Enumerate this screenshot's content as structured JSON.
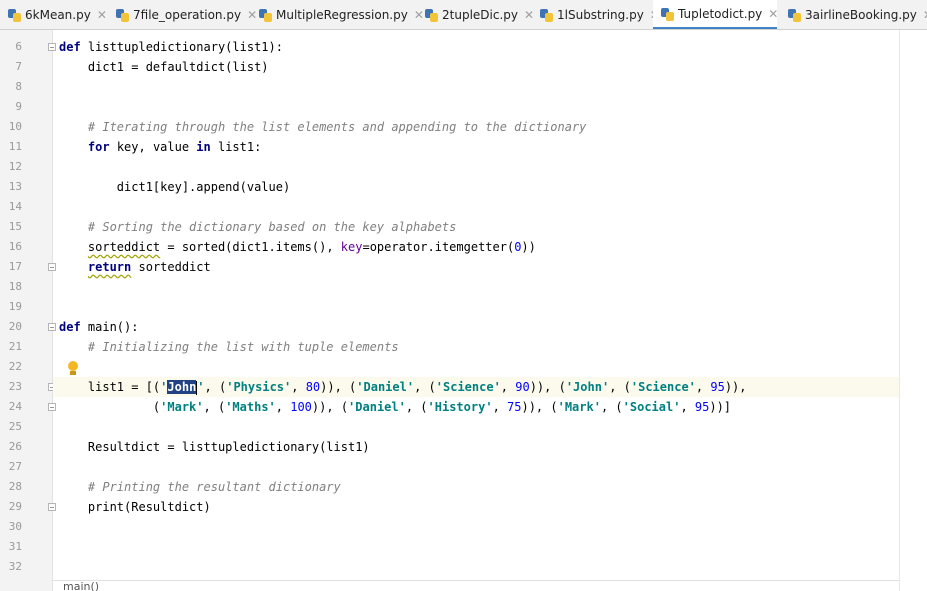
{
  "tabs": [
    {
      "label": "6kMean.py",
      "active": false
    },
    {
      "label": "7file_operation.py",
      "active": false
    },
    {
      "label": "MultipleRegression.py",
      "active": false
    },
    {
      "label": "2tupleDic.py",
      "active": false
    },
    {
      "label": "1lSubstring.py",
      "active": false
    },
    {
      "label": "Tupletodict.py",
      "active": true
    },
    {
      "label": "3airlineBooking.py",
      "active": false
    }
  ],
  "line_numbers": [
    "6",
    "7",
    "8",
    "9",
    "10",
    "11",
    "12",
    "13",
    "14",
    "15",
    "16",
    "17",
    "18",
    "19",
    "20",
    "21",
    "22",
    "23",
    "24",
    "25",
    "26",
    "27",
    "28",
    "29",
    "30",
    "31",
    "32"
  ],
  "code": {
    "l6": [
      "def",
      " listtupledictionary(list1):"
    ],
    "l7": "    dict1 = defaultdict(list)",
    "l10": "    # Iterating through the list elements and appending to the dictionary",
    "l11": [
      "    ",
      "for",
      " key, value ",
      "in",
      " list1:"
    ],
    "l13": "        dict1[key].append(value)",
    "l15": "    # Sorting the dictionary based on the key alphabets",
    "l16": [
      "    ",
      "sorteddict",
      " = sorted(dict1.items(), ",
      "key",
      "=operator.itemgetter(",
      "0",
      "))"
    ],
    "l17": [
      "    ",
      "return",
      " sorteddict"
    ],
    "l20": [
      "def",
      " main():"
    ],
    "l21": "    # Initializing the list with tuple elements",
    "l23": [
      "    list1 = [(",
      "'",
      "John",
      "'",
      ", (",
      "'Physics'",
      ", ",
      "80",
      ")), (",
      "'Daniel'",
      ", (",
      "'Science'",
      ", ",
      "90",
      ")), (",
      "'John'",
      ", (",
      "'Science'",
      ", ",
      "95",
      ")),"
    ],
    "l24": [
      "             (",
      "'Mark'",
      ", (",
      "'Maths'",
      ", ",
      "100",
      ")), (",
      "'Daniel'",
      ", (",
      "'History'",
      ", ",
      "75",
      ")), (",
      "'Mark'",
      ", (",
      "'Social'",
      ", ",
      "95",
      "))]"
    ],
    "l26": "    Resultdict = listtupledictionary(list1)",
    "l28": "    # Printing the resultant dictionary",
    "l29": "    print(Resultdict)"
  },
  "breadcrumb": "main()",
  "colors": {
    "keyword": "#000080",
    "comment": "#808080",
    "string": "#008080",
    "number": "#0000ff",
    "param": "#660099",
    "selection": "#214283",
    "current_line": "#fcfaed",
    "tab_active_underline": "#4083c9"
  },
  "icons": {
    "tab_file": "python-file-icon",
    "tab_close": "close-icon",
    "gutter_hint": "lightbulb-icon",
    "fold": "fold-marker-icon"
  }
}
